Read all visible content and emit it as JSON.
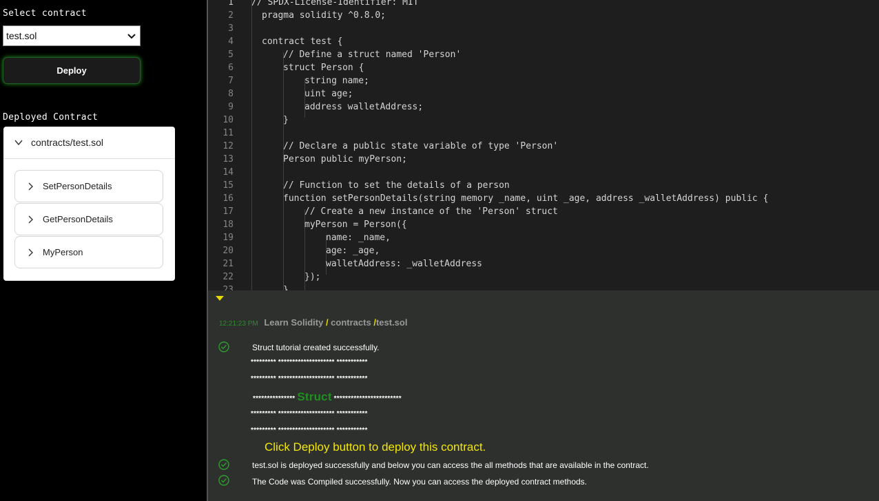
{
  "sidebar": {
    "select_label": "Select contract",
    "selected_contract": "test.sol",
    "deploy_label": "Deploy",
    "deployed_label": "Deployed Contract",
    "deployed_contract": "contracts/test.sol",
    "methods": [
      "SetPersonDetails",
      "GetPersonDetails",
      "MyPerson"
    ]
  },
  "editor": {
    "lines": [
      {
        "n": "1",
        "indent": 0,
        "text": "// SPDX-License-Identifier: MIT"
      },
      {
        "n": "2",
        "indent": 1,
        "text": "pragma solidity ^0.8.0;"
      },
      {
        "n": "3",
        "indent": 0,
        "text": ""
      },
      {
        "n": "4",
        "indent": 1,
        "text": "contract test {"
      },
      {
        "n": "5",
        "indent": 2,
        "text": "// Define a struct named 'Person'"
      },
      {
        "n": "6",
        "indent": 2,
        "text": "struct Person {"
      },
      {
        "n": "7",
        "indent": 3,
        "text": "string name;"
      },
      {
        "n": "8",
        "indent": 3,
        "text": "uint age;"
      },
      {
        "n": "9",
        "indent": 3,
        "text": "address walletAddress;"
      },
      {
        "n": "10",
        "indent": 2,
        "text": "}"
      },
      {
        "n": "11",
        "indent": 0,
        "text": ""
      },
      {
        "n": "12",
        "indent": 2,
        "text": "// Declare a public state variable of type 'Person'"
      },
      {
        "n": "13",
        "indent": 2,
        "text": "Person public myPerson;"
      },
      {
        "n": "14",
        "indent": 0,
        "text": ""
      },
      {
        "n": "15",
        "indent": 2,
        "text": "// Function to set the details of a person"
      },
      {
        "n": "16",
        "indent": 2,
        "text": "function setPersonDetails(string memory _name, uint _age, address _walletAddress) public {"
      },
      {
        "n": "17",
        "indent": 3,
        "text": "// Create a new instance of the 'Person' struct"
      },
      {
        "n": "18",
        "indent": 3,
        "text": "myPerson = Person({"
      },
      {
        "n": "19",
        "indent": 4,
        "text": "name: _name,"
      },
      {
        "n": "20",
        "indent": 4,
        "text": "age: _age,"
      },
      {
        "n": "21",
        "indent": 4,
        "text": "walletAddress: _walletAddress"
      },
      {
        "n": "22",
        "indent": 3,
        "text": "});"
      },
      {
        "n": "23",
        "indent": 2,
        "text": "}"
      }
    ]
  },
  "console": {
    "time": "12:21:23 PM",
    "crumbs": [
      "Learn Solidity",
      "contracts",
      "test.sol"
    ],
    "msg_created": "Struct tutorial created successfully.",
    "stars_a": "********* ******************** ***********",
    "stars_b": "********* ******************** ***********",
    "stars_c_left": "***************",
    "struct_word": "Struct",
    "stars_c_right": "************************",
    "stars_d": "********* ******************** ***********",
    "stars_e": "********* ******************** ***********",
    "deploy_hint": "Click Deploy button to deploy this contract.",
    "msg_deployed": "test.sol is deployed successfully and below you can access the all methods that are available in the contract.",
    "msg_compiled": "The Code was Compiled successfully. Now you can access the deployed contract methods."
  },
  "colors": {
    "accent_green": "#1f8f1f",
    "hint_yellow": "#f5e800"
  }
}
